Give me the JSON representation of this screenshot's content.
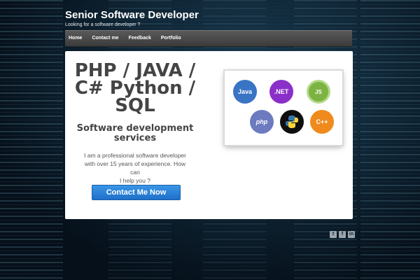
{
  "site": {
    "title": "Senior Software Developer",
    "tagline": "Looking for a software developer ?"
  },
  "nav": {
    "items": [
      {
        "label": "Home"
      },
      {
        "label": "Contact me"
      },
      {
        "label": "Feedback"
      },
      {
        "label": "Portfolio"
      }
    ]
  },
  "hero": {
    "headline_lines": [
      "PHP / JAVA /",
      "C# Python /",
      "SQL"
    ],
    "subheading_lines": [
      "Software development",
      "services"
    ],
    "description_lines": [
      "I am a professional software developer",
      "with over 15 years of experience. How can",
      "I help you ?"
    ],
    "cta_label": "Contact Me Now"
  },
  "languages": [
    {
      "label": "Java",
      "color": "#3a74c4"
    },
    {
      "label": ".NET",
      "color": "#8b2fc9"
    },
    {
      "label": "JS",
      "color": "#7cb342"
    },
    {
      "label": "php",
      "color": "#6c7bbf"
    },
    {
      "label": "Python",
      "color": "#0f0f0f"
    },
    {
      "label": "C++",
      "color": "#f08a1c"
    }
  ],
  "social": [
    {
      "icon": "twitter-icon",
      "glyph": "t"
    },
    {
      "icon": "facebook-icon",
      "glyph": "f"
    },
    {
      "icon": "linkedin-icon",
      "glyph": "in"
    }
  ],
  "colors": {
    "accent": "#2a83d8",
    "navbar": "#4a4a4a"
  }
}
